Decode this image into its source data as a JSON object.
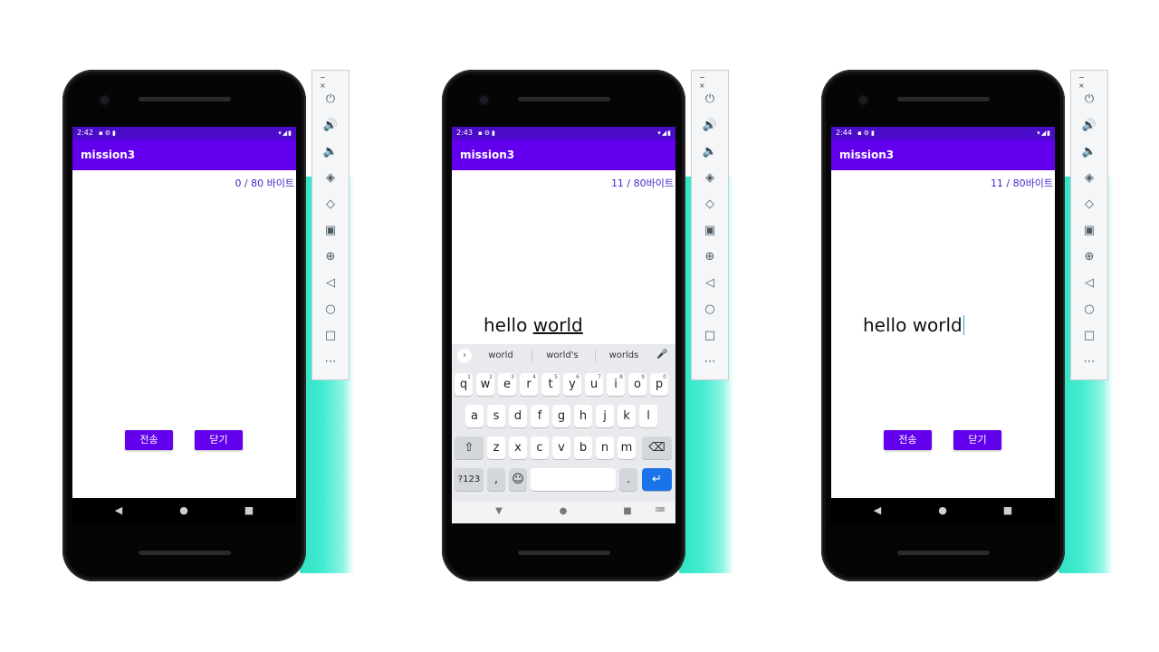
{
  "devices": [
    {
      "status_time": "2:42",
      "app_title": "mission3",
      "counter": "0 / 80 바이트",
      "text_plain": "",
      "text_underlined": "",
      "send_label": "전송",
      "close_label": "닫기",
      "keyboard_visible": false
    },
    {
      "status_time": "2:43",
      "app_title": "mission3",
      "counter": "11 / 80바이트",
      "text_plain": "hello ",
      "text_underlined": "world",
      "keyboard_visible": true,
      "keyboard": {
        "suggestions": [
          "world",
          "world's",
          "worlds"
        ],
        "row1": [
          "q",
          "w",
          "e",
          "r",
          "t",
          "y",
          "u",
          "i",
          "o",
          "p"
        ],
        "row1_digits": [
          "1",
          "2",
          "3",
          "4",
          "5",
          "6",
          "7",
          "8",
          "9",
          "0"
        ],
        "row2": [
          "a",
          "s",
          "d",
          "f",
          "g",
          "h",
          "j",
          "k",
          "l"
        ],
        "row3": [
          "z",
          "x",
          "c",
          "v",
          "b",
          "n",
          "m"
        ],
        "symbols_key": "?123",
        "comma_key": ",",
        "period_key": "."
      }
    },
    {
      "status_time": "2:44",
      "app_title": "mission3",
      "counter": "11 / 80바이트",
      "text_plain": "hello world",
      "text_underlined": "",
      "send_label": "전송",
      "close_label": "닫기",
      "keyboard_visible": false
    }
  ],
  "emulator_toolbar": {
    "window_buttons": "−  ×",
    "tools": [
      "power-icon",
      "volume-up-icon",
      "volume-down-icon",
      "rotate-left-icon",
      "rotate-right-icon",
      "camera-icon",
      "zoom-icon",
      "back-icon",
      "home-icon",
      "overview-icon",
      "more-icon"
    ]
  },
  "colors": {
    "app_bar": "#6200ee",
    "status_bar": "#4a0cc9",
    "counter_text": "#3a2bcb",
    "teal_brush": "#2fe3c4",
    "enter_key": "#1a73e8"
  }
}
